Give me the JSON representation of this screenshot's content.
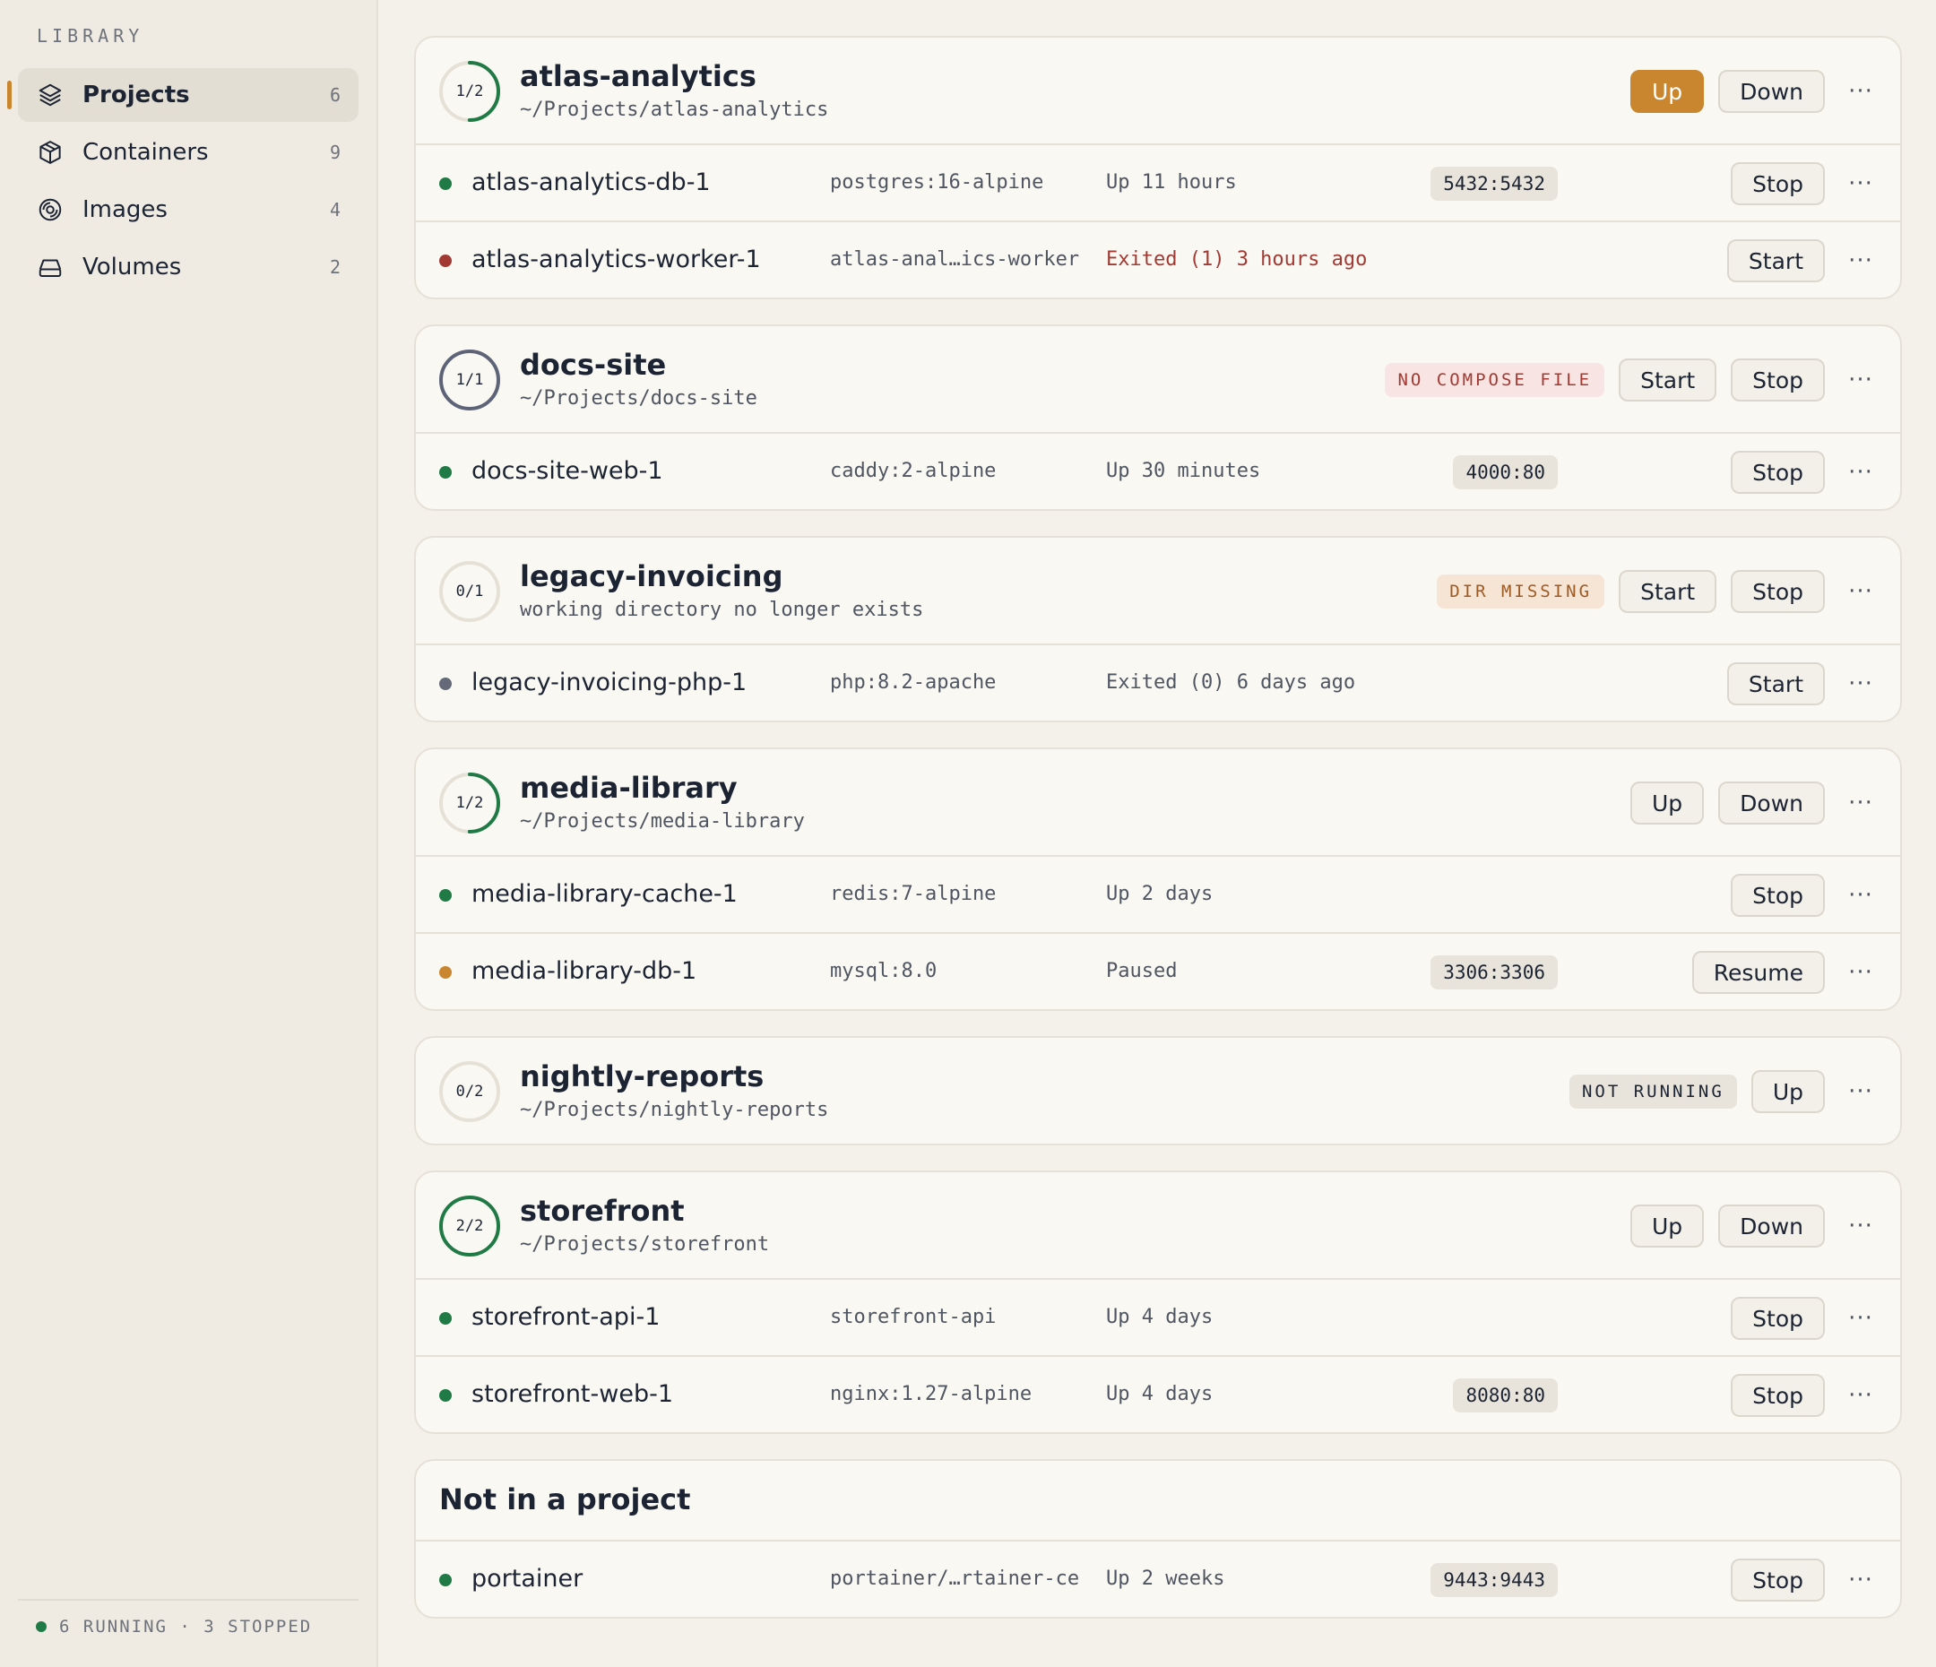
{
  "sidebar": {
    "heading": "LIBRARY",
    "items": [
      {
        "label": "Projects",
        "count": "6"
      },
      {
        "label": "Containers",
        "count": "9"
      },
      {
        "label": "Images",
        "count": "4"
      },
      {
        "label": "Volumes",
        "count": "2"
      }
    ],
    "footer": "6 RUNNING · 3 STOPPED"
  },
  "colors": {
    "accent": "#c9862f",
    "running": "#1f7a45",
    "error": "#a23a33",
    "stopped": "#646a78"
  },
  "projects": [
    {
      "ratio": "1/2",
      "running_fraction": 0.5,
      "name": "atlas-analytics",
      "path": "~/Projects/atlas-analytics",
      "actions": [
        "Up",
        "Down"
      ],
      "more": "···",
      "containers": [
        {
          "name": "atlas-analytics-db-1",
          "image": "postgres:16-alpine",
          "status": "Up 11 hours",
          "port": "5432:5432",
          "action": "Stop"
        },
        {
          "name": "atlas-analytics-worker-1",
          "image": "atlas-anal…ics-worker",
          "status": "Exited (1) 3 hours ago",
          "action": "Start"
        }
      ]
    },
    {
      "ratio": "1/1",
      "running_fraction": 1,
      "name": "docs-site",
      "path": "~/Projects/docs-site",
      "badge": "NO COMPOSE FILE",
      "actions": [
        "Start",
        "Stop"
      ],
      "containers": [
        {
          "name": "docs-site-web-1",
          "image": "caddy:2-alpine",
          "status": "Up 30 minutes",
          "port": "4000:80",
          "action": "Stop"
        }
      ]
    },
    {
      "ratio": "0/1",
      "running_fraction": 0,
      "name": "legacy-invoicing",
      "path": "working directory no longer exists",
      "badge": "DIR MISSING",
      "actions": [
        "Start",
        "Stop"
      ],
      "containers": [
        {
          "name": "legacy-invoicing-php-1",
          "image": "php:8.2-apache",
          "status": "Exited (0) 6 days ago",
          "action": "Start"
        }
      ]
    },
    {
      "ratio": "1/2",
      "running_fraction": 0.5,
      "name": "media-library",
      "path": "~/Projects/media-library",
      "actions": [
        "Up",
        "Down"
      ],
      "containers": [
        {
          "name": "media-library-cache-1",
          "image": "redis:7-alpine",
          "status": "Up 2 days",
          "action": "Stop"
        },
        {
          "name": "media-library-db-1",
          "image": "mysql:8.0",
          "status": "Paused",
          "port": "3306:3306",
          "action": "Resume"
        }
      ]
    },
    {
      "ratio": "0/2",
      "running_fraction": 0,
      "name": "nightly-reports",
      "path": "~/Projects/nightly-reports",
      "badge": "NOT RUNNING",
      "actions": [
        "Up"
      ]
    },
    {
      "ratio": "2/2",
      "running_fraction": 1,
      "name": "storefront",
      "path": "~/Projects/storefront",
      "actions": [
        "Up",
        "Down"
      ],
      "containers": [
        {
          "name": "storefront-api-1",
          "image": "storefront-api",
          "status": "Up 4 days",
          "action": "Stop"
        },
        {
          "name": "storefront-web-1",
          "image": "nginx:1.27-alpine",
          "status": "Up 4 days",
          "port": "8080:80",
          "action": "Stop"
        }
      ]
    }
  ],
  "unassigned": {
    "title": "Not in a project",
    "containers": [
      {
        "name": "portainer",
        "image": "portainer/…rtainer-ce",
        "status": "Up 2 weeks",
        "port": "9443:9443",
        "action": "Stop"
      }
    ]
  }
}
